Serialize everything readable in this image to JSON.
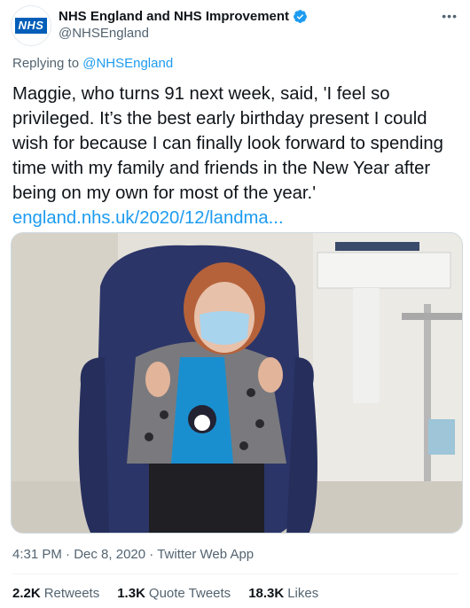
{
  "author": {
    "display_name": "NHS England and NHS Improvement",
    "handle": "@NHSEngland",
    "avatar_logo_text": "NHS",
    "verified": true
  },
  "more_icon": "more-horizontal-icon",
  "reply": {
    "prefix": "Replying to",
    "to": "@NHSEngland"
  },
  "tweet": {
    "text": "Maggie, who turns 91 next week, said, 'I feel so privileged. It’s the best early birthday present I could wish for because I can finally look forward to spending time with my family and friends in the New Year after being on my own for most of the year.'",
    "link": "england.nhs.uk/2020/12/landma..."
  },
  "meta": {
    "time": "4:31 PM",
    "sep1": "·",
    "date": "Dec 8, 2020",
    "sep2": "·",
    "source": "Twitter Web App"
  },
  "stats": {
    "retweets_count": "2.2K",
    "retweets_label": "Retweets",
    "quotes_count": "1.3K",
    "quotes_label": "Quote Tweets",
    "likes_count": "18.3K",
    "likes_label": "Likes"
  },
  "colors": {
    "link": "#1d9bf0",
    "secondary_text": "#536471",
    "nhs_blue": "#005eb8"
  }
}
